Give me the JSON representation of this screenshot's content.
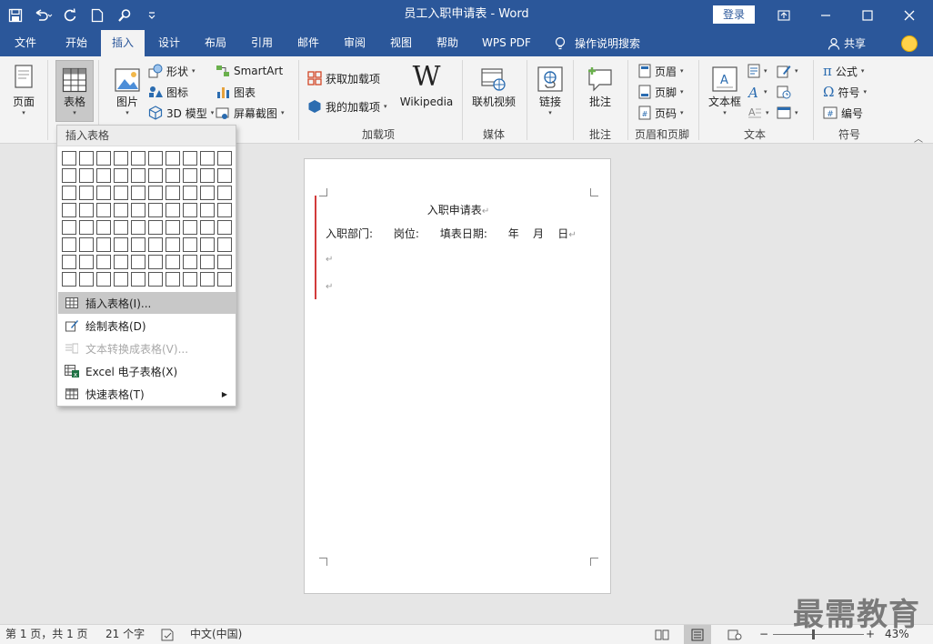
{
  "app": {
    "title": "员工入职申请表  -  Word",
    "login_label": "登录"
  },
  "tabs": [
    {
      "label": "文件"
    },
    {
      "label": "开始"
    },
    {
      "label": "插入"
    },
    {
      "label": "设计"
    },
    {
      "label": "布局"
    },
    {
      "label": "引用"
    },
    {
      "label": "邮件"
    },
    {
      "label": "审阅"
    },
    {
      "label": "视图"
    },
    {
      "label": "帮助"
    },
    {
      "label": "WPS PDF"
    }
  ],
  "active_tab": "插入",
  "tell_me": "操作说明搜索",
  "share_label": "共享",
  "ribbon": {
    "pages": "页面",
    "table": "表格",
    "picture": "图片",
    "shapes": "形状",
    "icons": "图标",
    "model3d": "3D 模型",
    "smartart": "SmartArt",
    "chart": "图表",
    "screenshot": "屏幕截图",
    "get_addins": "获取加载项",
    "my_addins": "我的加载项",
    "wikipedia": "Wikipedia",
    "addins_group": "加载项",
    "online_video": "联机视频",
    "media_group": "媒体",
    "link": "链接",
    "comment": "批注",
    "comment_group": "批注",
    "header": "页眉",
    "footer": "页脚",
    "page_number": "页码",
    "header_footer_group": "页眉和页脚",
    "textbox": "文本框",
    "text_group": "文本",
    "equation": "公式",
    "symbol": "符号",
    "numbering": "编号",
    "symbol_group": "符号"
  },
  "dropdown": {
    "header": "插入表格",
    "items": [
      {
        "label": "插入表格(I)..."
      },
      {
        "label": "绘制表格(D)"
      },
      {
        "label": "文本转换成表格(V)..."
      },
      {
        "label": "Excel 电子表格(X)"
      },
      {
        "label": "快速表格(T)"
      }
    ]
  },
  "document": {
    "title": "入职申请表",
    "line": "入职部门:      岗位:      填表日期:      年    月    日",
    "pilcrow": "↵"
  },
  "status": {
    "page": "第 1 页，共 1 页",
    "words": "21 个字",
    "language": "中文(中国)",
    "zoom": "43%"
  },
  "watermark": "最需教育",
  "colors": {
    "accent": "#2b579a",
    "ribbon_bg": "#f3f3f3",
    "margin_mark": "#d23b3b"
  }
}
